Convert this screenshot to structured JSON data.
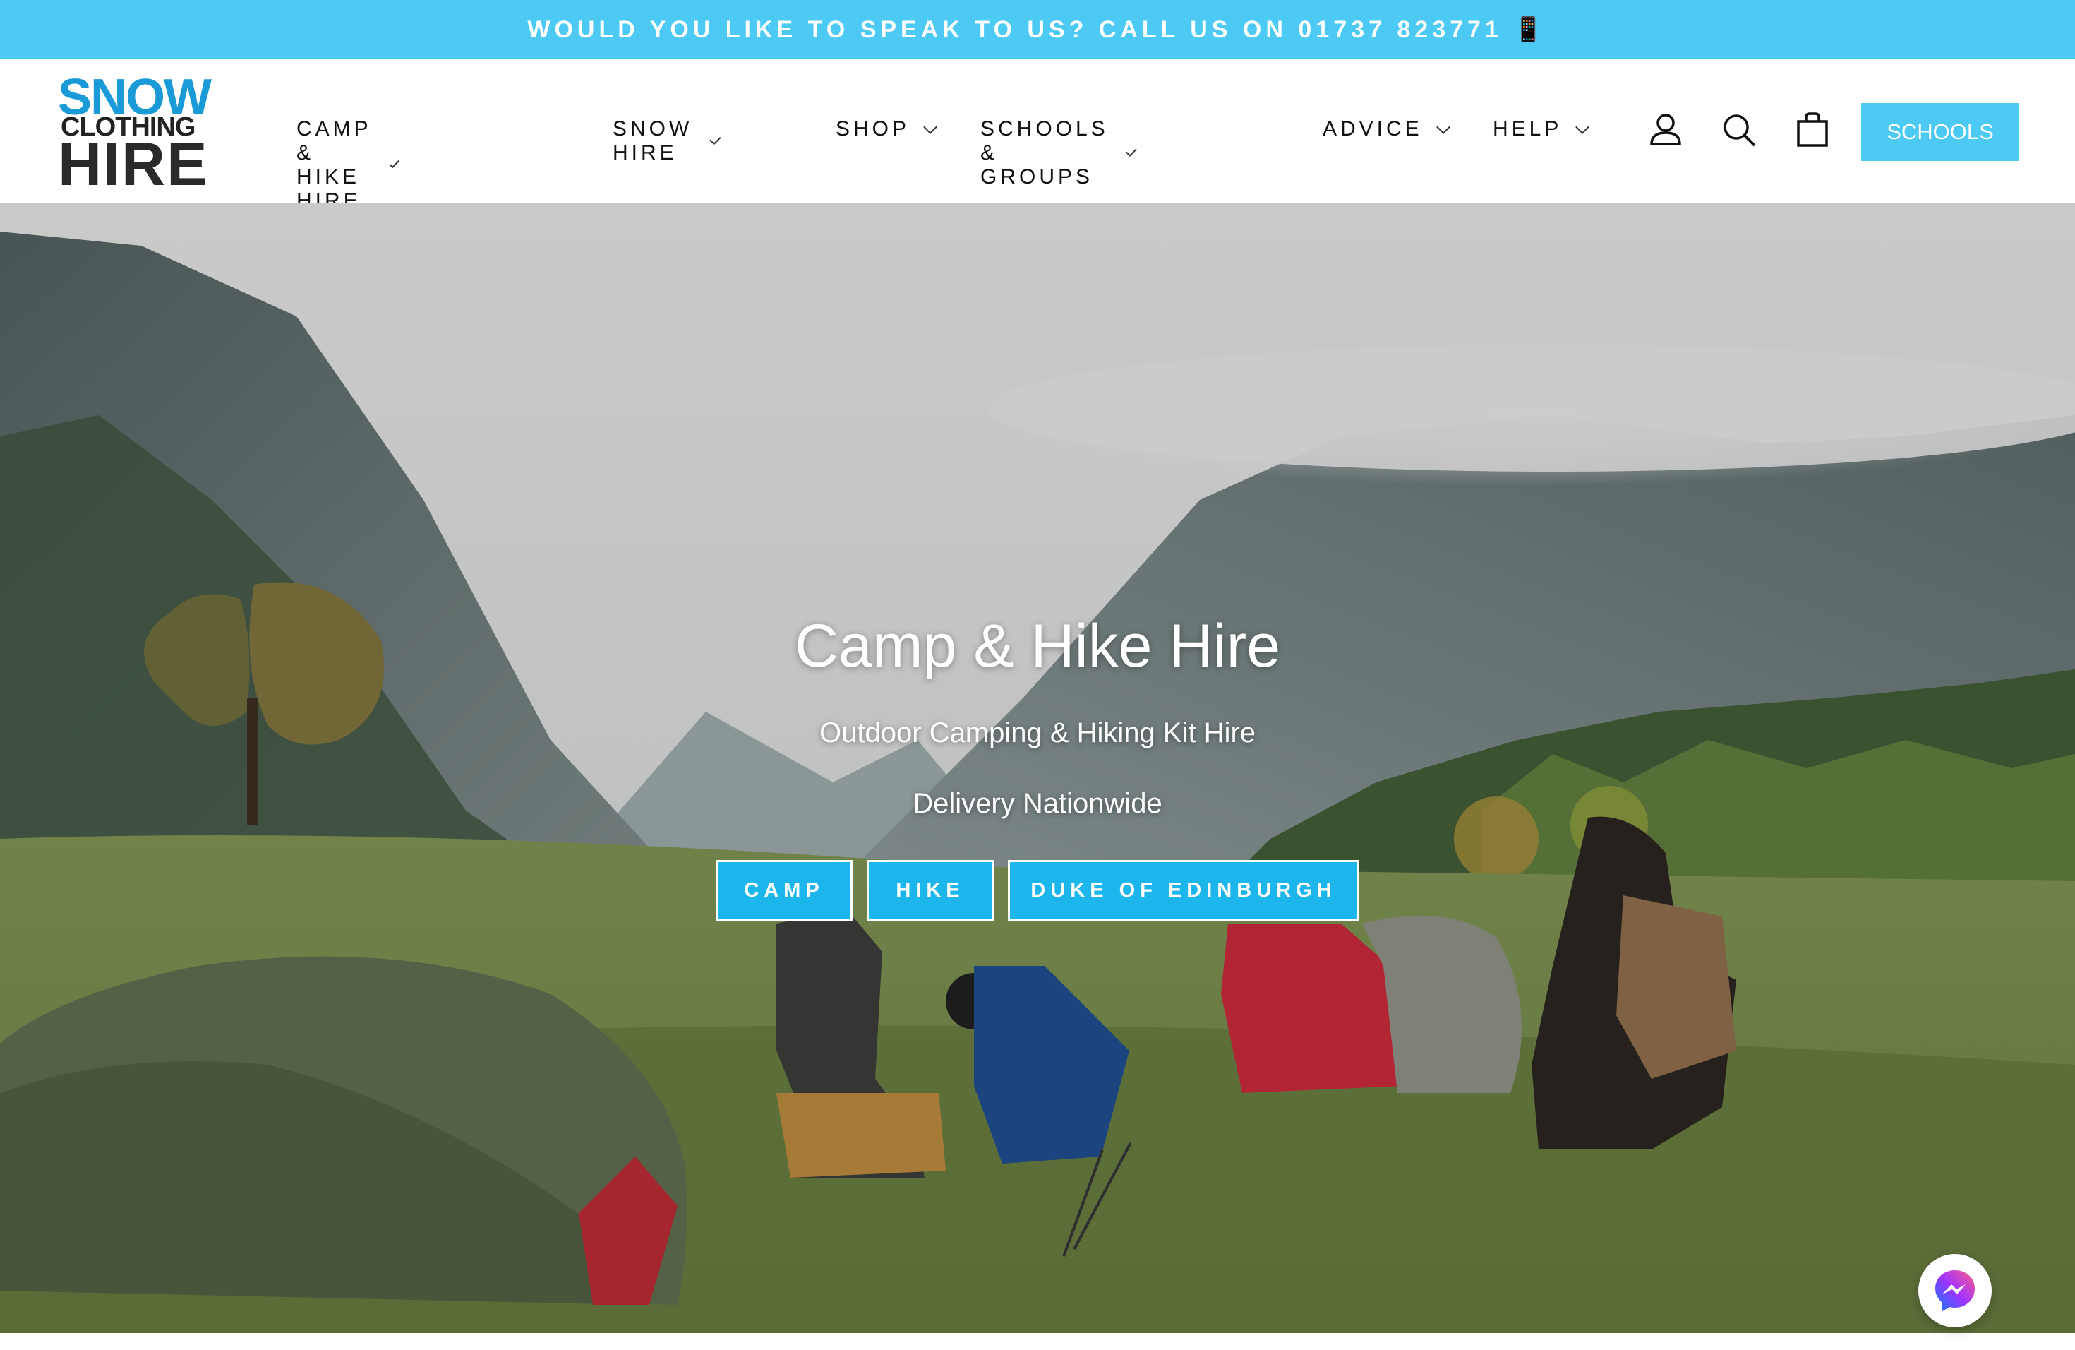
{
  "announcement": {
    "text": "WOULD YOU LIKE TO SPEAK TO US? CALL US ON 01737 823771 📱"
  },
  "logo": {
    "line1": "SNOW",
    "line2": "CLOTHING",
    "line3": "HIRE"
  },
  "nav": {
    "items": [
      {
        "label": "CAMP & HIKE HIRE"
      },
      {
        "label": "SNOW HIRE"
      },
      {
        "label": "SHOP"
      },
      {
        "label": "SCHOOLS & GROUPS"
      },
      {
        "label": "ADVICE"
      },
      {
        "label": "HELP"
      }
    ]
  },
  "header_icons": [
    "user-icon",
    "search-icon",
    "cart-icon"
  ],
  "schools_button": {
    "label": "SCHOOLS"
  },
  "hero": {
    "title": "Camp & Hike Hire",
    "subtitle": "Outdoor Camping & Hiking Kit Hire",
    "tagline": "Delivery Nationwide",
    "buttons": [
      {
        "label": "CAMP"
      },
      {
        "label": "HIKE"
      },
      {
        "label": "DUKE OF EDINBURGH"
      }
    ]
  },
  "messenger": {
    "icon": "messenger-icon"
  },
  "colors": {
    "accent": "#4ccaf3",
    "button": "#1cb5ec",
    "logo_blue": "#1a9bd7"
  }
}
